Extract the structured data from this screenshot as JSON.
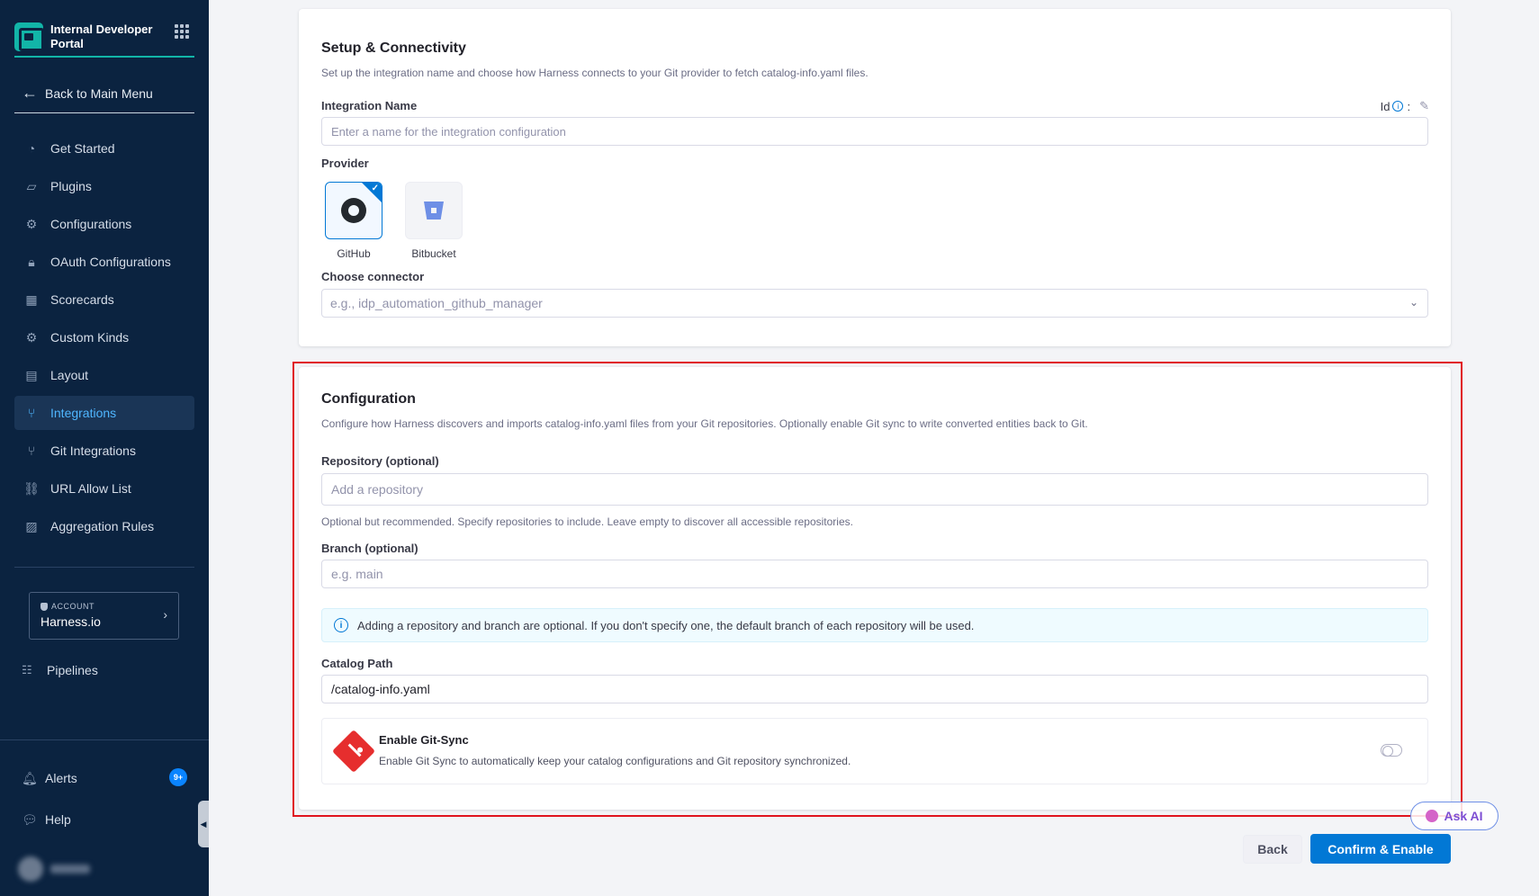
{
  "sidebar": {
    "brand_title": "Internal Developer Portal",
    "back_label": "Back to Main Menu",
    "items": [
      {
        "label": "Get Started",
        "icon": "rocket-icon",
        "glyph": "◔"
      },
      {
        "label": "Plugins",
        "icon": "plug-icon",
        "glyph": "▱"
      },
      {
        "label": "Configurations",
        "icon": "gears-icon",
        "glyph": "⚙"
      },
      {
        "label": "OAuth Configurations",
        "icon": "lock-icon",
        "glyph": "🔒︎"
      },
      {
        "label": "Scorecards",
        "icon": "scorecard-icon",
        "glyph": "▦"
      },
      {
        "label": "Custom Kinds",
        "icon": "gear-icon",
        "glyph": "⚙"
      },
      {
        "label": "Layout",
        "icon": "layout-icon",
        "glyph": "▤"
      },
      {
        "label": "Integrations",
        "icon": "integrations-icon",
        "glyph": "⑂"
      },
      {
        "label": "Git Integrations",
        "icon": "git-branch-icon",
        "glyph": "⑂"
      },
      {
        "label": "URL Allow List",
        "icon": "link-icon",
        "glyph": "⛓"
      },
      {
        "label": "Aggregation Rules",
        "icon": "aggregation-icon",
        "glyph": "▨"
      }
    ],
    "active_index": 7,
    "account": {
      "label": "ACCOUNT",
      "name": "Harness.io"
    },
    "pipelines_label": "Pipelines",
    "alerts_label": "Alerts",
    "alerts_badge": "9+",
    "help_label": "Help"
  },
  "setup": {
    "title": "Setup & Connectivity",
    "description": "Set up the integration name and choose how Harness connects to your Git provider to fetch catalog-info.yaml files.",
    "name_label": "Integration Name",
    "id_label": "Id",
    "id_separator": ":",
    "name_placeholder": "Enter a name for the integration configuration",
    "provider_label": "Provider",
    "providers": [
      {
        "label": "GitHub",
        "selected": true
      },
      {
        "label": "Bitbucket",
        "selected": false
      }
    ],
    "connector_label": "Choose connector",
    "connector_placeholder": "e.g., idp_automation_github_manager"
  },
  "configuration": {
    "title": "Configuration",
    "description": "Configure how Harness discovers and imports catalog-info.yaml files from your Git repositories. Optionally enable Git sync to write converted entities back to Git.",
    "repo_label": "Repository (optional)",
    "repo_placeholder": "Add a repository",
    "repo_helper": "Optional but recommended. Specify repositories to include. Leave empty to discover all accessible repositories.",
    "branch_label": "Branch (optional)",
    "branch_placeholder": "e.g. main",
    "info_text": "Adding a repository and branch are optional. If you don't specify one, the default branch of each repository will be used.",
    "catalog_path_label": "Catalog Path",
    "catalog_path_value": "/catalog-info.yaml",
    "gitsync_title": "Enable Git-Sync",
    "gitsync_desc": "Enable Git Sync to automatically keep your catalog configurations and Git repository synchronized.",
    "gitsync_enabled": false
  },
  "footer": {
    "ask_ai_label": "Ask AI",
    "back_label": "Back",
    "confirm_label": "Confirm & Enable"
  },
  "colors": {
    "sidebar_bg": "#0b2340",
    "accent": "#0278d5",
    "brand_teal": "#12b5a8",
    "highlight_red": "#e0141e"
  }
}
